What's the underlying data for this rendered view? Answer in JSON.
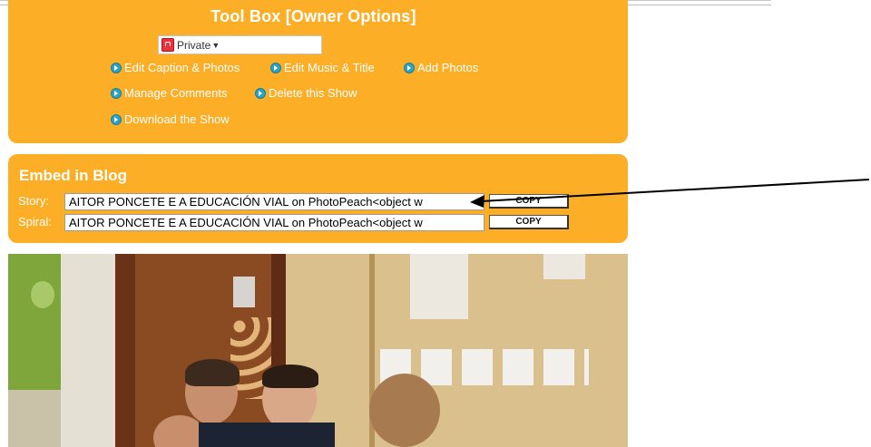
{
  "toolbox": {
    "title": "Tool Box [Owner Options]",
    "privacy_select": "Private",
    "links": {
      "edit_caption": "Edit Caption & Photos",
      "edit_music": "Edit Music & Title",
      "add_photos": "Add Photos",
      "manage_comments": "Manage Comments",
      "delete_show": "Delete this Show",
      "download_show": "Download the Show"
    }
  },
  "embed": {
    "title": "Embed in Blog",
    "story_label": "Story:",
    "story_value": "AITOR PONCETE E A EDUCACIÓN VIAL on PhotoPeach<object w",
    "spiral_label": "Spiral:",
    "spiral_value": "AITOR PONCETE E A EDUCACIÓN VIAL on PhotoPeach<object w",
    "copy_label": "COPY"
  },
  "colors": {
    "panel": "#fbae26",
    "link_bullet": "#2aa3c4"
  },
  "icons": [
    "lock-icon",
    "play-bullet-icon",
    "annotation-arrow-icon"
  ]
}
